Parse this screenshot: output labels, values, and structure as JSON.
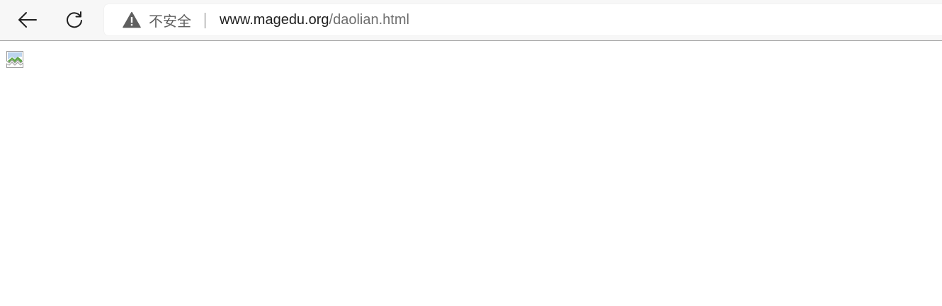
{
  "toolbar": {
    "back_icon": "arrow-left-icon",
    "reload_icon": "reload-icon"
  },
  "address_bar": {
    "security_icon": "warning-triangle-icon",
    "security_label": "不安全",
    "url_host": "www.magedu.org",
    "url_path": "/daolian.html"
  },
  "page": {
    "content_icon": "broken-image-icon"
  }
}
